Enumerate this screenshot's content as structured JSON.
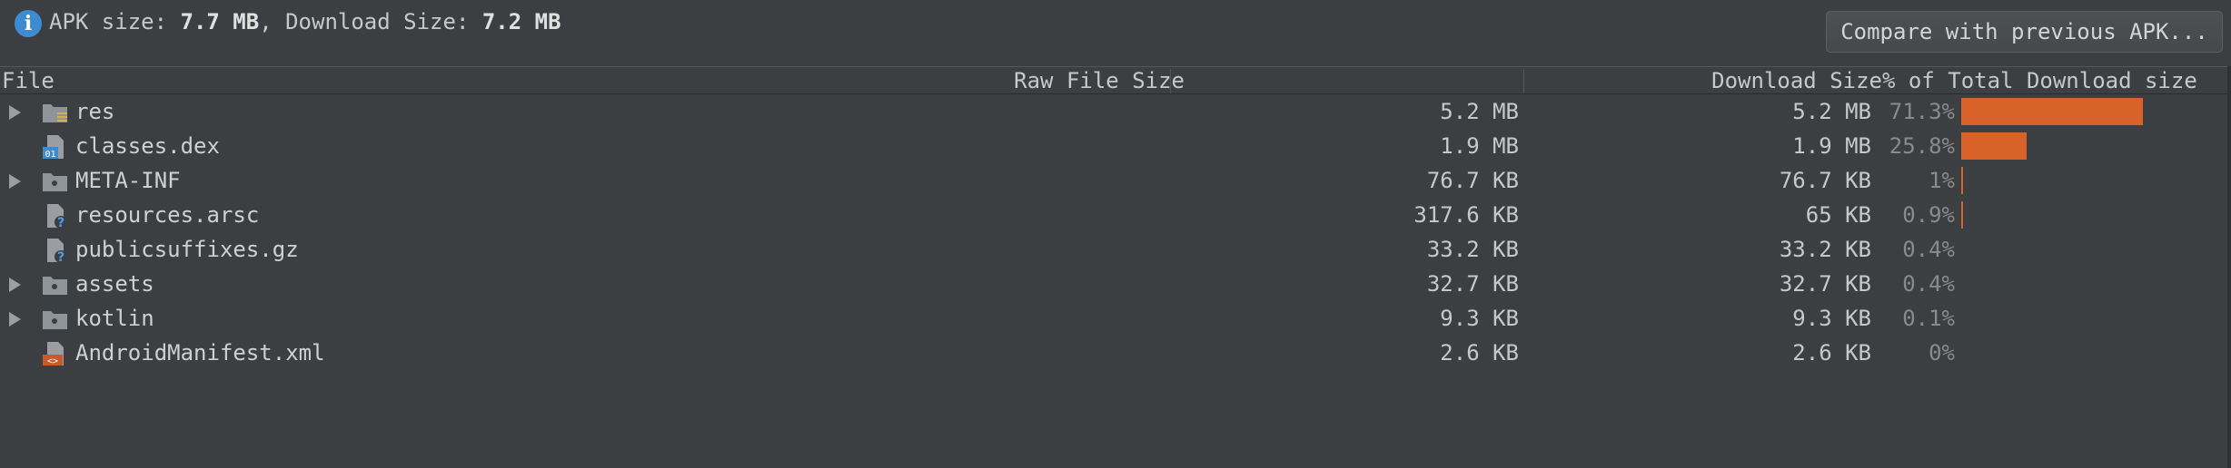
{
  "summary": {
    "apk_label": "APK size: ",
    "apk_value": "7.7 MB",
    "sep": ", Download Size: ",
    "download_value": "7.2 MB"
  },
  "compare_button": "Compare with previous APK...",
  "columns": {
    "file": "File",
    "raw": "Raw File Size",
    "download": "Download Size",
    "percent": "% of Total Download size"
  },
  "rows": [
    {
      "name": "res",
      "raw": "5.2 MB",
      "download": "5.2 MB",
      "percent": "71.3%",
      "pct_value": 71.3,
      "expandable": true,
      "icon": "res-folder-icon"
    },
    {
      "name": "classes.dex",
      "raw": "1.9 MB",
      "download": "1.9 MB",
      "percent": "25.8%",
      "pct_value": 25.8,
      "expandable": false,
      "icon": "dex-file-icon"
    },
    {
      "name": "META-INF",
      "raw": "76.7 KB",
      "download": "76.7 KB",
      "percent": "1%",
      "pct_value": 1,
      "expandable": true,
      "icon": "folder-icon"
    },
    {
      "name": "resources.arsc",
      "raw": "317.6 KB",
      "download": "65 KB",
      "percent": "0.9%",
      "pct_value": 0.9,
      "expandable": false,
      "icon": "unknown-file-icon"
    },
    {
      "name": "publicsuffixes.gz",
      "raw": "33.2 KB",
      "download": "33.2 KB",
      "percent": "0.4%",
      "pct_value": 0.4,
      "expandable": false,
      "icon": "unknown-file-icon"
    },
    {
      "name": "assets",
      "raw": "32.7 KB",
      "download": "32.7 KB",
      "percent": "0.4%",
      "pct_value": 0.4,
      "expandable": true,
      "icon": "folder-icon"
    },
    {
      "name": "kotlin",
      "raw": "9.3 KB",
      "download": "9.3 KB",
      "percent": "0.1%",
      "pct_value": 0.1,
      "expandable": true,
      "icon": "folder-icon"
    },
    {
      "name": "AndroidManifest.xml",
      "raw": "2.6 KB",
      "download": "2.6 KB",
      "percent": "0%",
      "pct_value": 0,
      "expandable": false,
      "icon": "xml-file-icon"
    }
  ],
  "colors": {
    "background": "#3c3f41",
    "bar": "#d9622b",
    "info": "#3f8bd2"
  }
}
